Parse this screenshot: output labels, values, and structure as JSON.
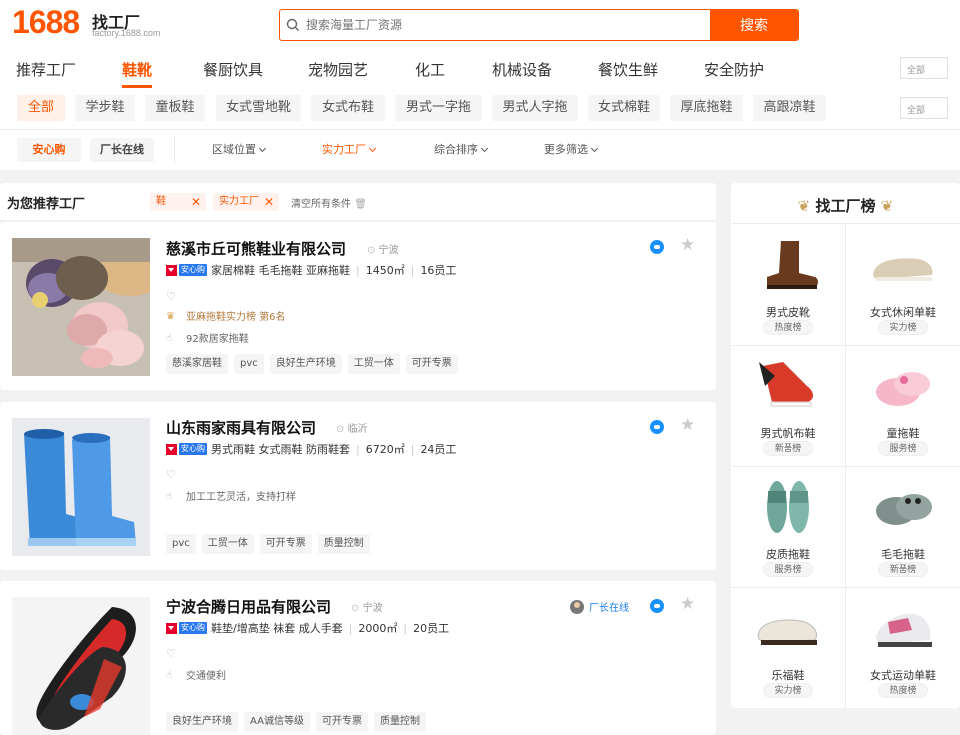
{
  "header": {
    "logo_number": "1688",
    "logo_name": "找工厂",
    "logo_domain": "factory.1688.com",
    "search_placeholder": "搜索海量工厂资源",
    "search_button": "搜索"
  },
  "categories": [
    "推荐工厂",
    "鞋靴",
    "餐厨饮具",
    "宠物园艺",
    "化工",
    "机械设备",
    "餐饮生鲜",
    "安全防护"
  ],
  "active_category": "鞋靴",
  "all_label": "全部",
  "subcategories": [
    "全部",
    "学步鞋",
    "童板鞋",
    "女式雪地靴",
    "女式布鞋",
    "男式一字拖",
    "男式人字拖",
    "女式棉鞋",
    "厚底拖鞋",
    "高跟凉鞋"
  ],
  "filters": {
    "anxin": "安心购",
    "online": "厂长在线",
    "region": "区域位置",
    "strength": "实力工厂",
    "sort": "综合排序",
    "more": "更多筛选"
  },
  "list": {
    "title": "为您推荐工厂",
    "chips": [
      "鞋",
      "实力工厂"
    ],
    "clear": "清空所有条件"
  },
  "badge_text": "安心购",
  "factories": [
    {
      "name": "慈溪市丘可熊鞋业有限公司",
      "city": "宁波",
      "products": "家居棉鞋 毛毛拖鞋 亚麻拖鞋",
      "area": "1450㎡",
      "staff": "16员工",
      "rank_text": "亚麻拖鞋实力榜 第6名",
      "note": "92款居家拖鞋",
      "tags": [
        "慈溪家居鞋",
        "pvc",
        "良好生产环境",
        "工贸一体",
        "可开专票"
      ]
    },
    {
      "name": "山东雨家雨具有限公司",
      "city": "临沂",
      "products": "男式雨鞋 女式雨鞋 防雨鞋套",
      "area": "6720㎡",
      "staff": "24员工",
      "note": "加工工艺灵活，支持打样",
      "tags": [
        "pvc",
        "工贸一体",
        "可开专票",
        "质量控制"
      ]
    },
    {
      "name": "宁波合腾日用品有限公司",
      "city": "宁波",
      "products": "鞋垫/增高垫 袜套 成人手套",
      "area": "2000㎡",
      "staff": "20员工",
      "online": "厂长在线",
      "note": "交通便利",
      "tags": [
        "良好生产环境",
        "AA诚信等级",
        "可开专票",
        "质量控制"
      ]
    }
  ],
  "ranking": {
    "title": "找工厂榜",
    "items": [
      {
        "name": "男式皮靴",
        "badge": "热度榜",
        "icon": "boot-icon"
      },
      {
        "name": "女式休闲单鞋",
        "badge": "实力榜",
        "icon": "loafer-icon"
      },
      {
        "name": "男式帆布鞋",
        "badge": "新품榜",
        "icon": "sneaker-icon"
      },
      {
        "name": "童拖鞋",
        "badge": "服务榜",
        "icon": "kids-slipper-icon"
      },
      {
        "name": "皮质拖鞋",
        "badge": "服务榜",
        "icon": "slide-icon"
      },
      {
        "name": "毛毛拖鞋",
        "badge": "新품榜",
        "icon": "fluffy-slipper-icon"
      },
      {
        "name": "乐福鞋",
        "badge": "实力榜",
        "icon": "loafer-icon"
      },
      {
        "name": "女式运动单鞋",
        "badge": "热度榜",
        "icon": "running-shoe-icon"
      }
    ]
  },
  "colors": {
    "brand": "#ff5500",
    "link": "#1a7ef5",
    "badge_blue": "#2a78f0",
    "badge_red": "#e4002b"
  }
}
